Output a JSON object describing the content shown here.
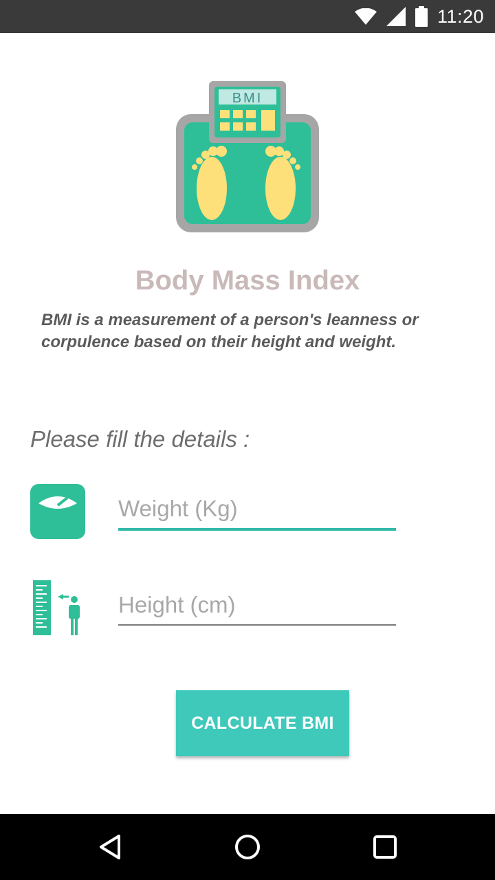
{
  "status_bar": {
    "time": "11:20",
    "icons": [
      "wifi-icon",
      "signal-icon",
      "battery-icon"
    ]
  },
  "logo": {
    "text": "BMI"
  },
  "title": "Body Mass Index",
  "description": "BMI is a measurement of a person's leanness or corpulence based on their height and weight.",
  "prompt": "Please fill the details :",
  "weight": {
    "placeholder": "Weight (Kg)",
    "value": "",
    "icon": "weighing-scale-icon"
  },
  "height": {
    "placeholder": "Height (cm)",
    "value": "",
    "icon": "height-measure-icon"
  },
  "calculate_label": "CALCULATE BMI",
  "nav_bar": {
    "icons": [
      "back-icon",
      "home-icon",
      "recents-icon"
    ]
  },
  "colors": {
    "accent": "#3ec9bb",
    "scale_green": "#2fbf98",
    "feet_yellow": "#fde07a",
    "title": "#c9b9b9"
  }
}
